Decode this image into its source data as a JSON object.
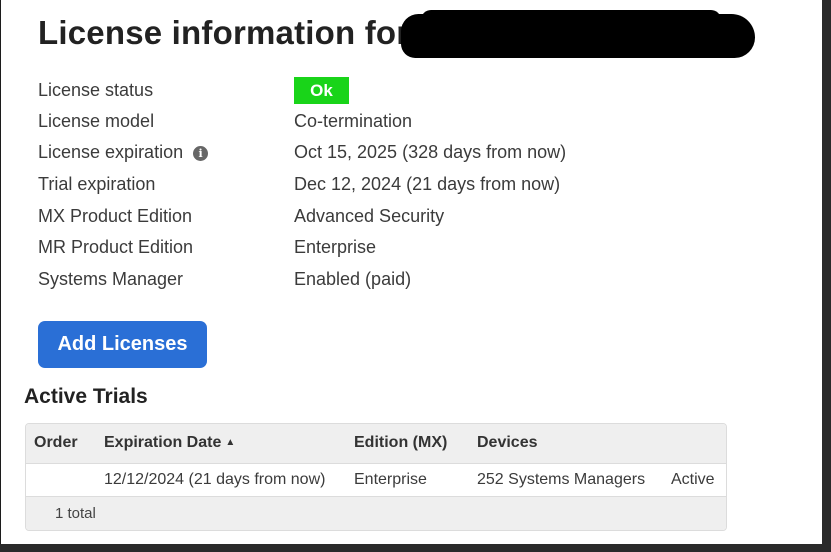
{
  "page": {
    "title": "License information for"
  },
  "license": {
    "rows": [
      {
        "label": "License status",
        "value": "Ok"
      },
      {
        "label": "License model",
        "value": "Co-termination"
      },
      {
        "label": "License expiration",
        "value": "Oct 15, 2025 (328 days from now)"
      },
      {
        "label": "Trial expiration",
        "value": "Dec 12, 2024 (21 days from now)"
      },
      {
        "label": "MX Product Edition",
        "value": "Advanced Security"
      },
      {
        "label": "MR Product Edition",
        "value": "Enterprise"
      },
      {
        "label": "Systems Manager",
        "value": "Enabled (paid)"
      }
    ],
    "expiration_info_icon": "i"
  },
  "actions": {
    "add_licenses": "Add Licenses"
  },
  "active_trials": {
    "title": "Active Trials",
    "columns": {
      "order": "Order",
      "expiration_date": "Expiration Date",
      "sort_indicator": "▲",
      "edition": "Edition (MX)",
      "devices": "Devices"
    },
    "rows": [
      {
        "order": "",
        "expiration_date": "12/12/2024 (21 days from now)",
        "edition": "Enterprise",
        "devices": "252 Systems Managers",
        "status": "Active"
      }
    ],
    "footer": "1 total"
  },
  "colors": {
    "ok_badge": "#19d419",
    "primary_button": "#2a6fd6",
    "table_header_bg": "#efefef"
  }
}
